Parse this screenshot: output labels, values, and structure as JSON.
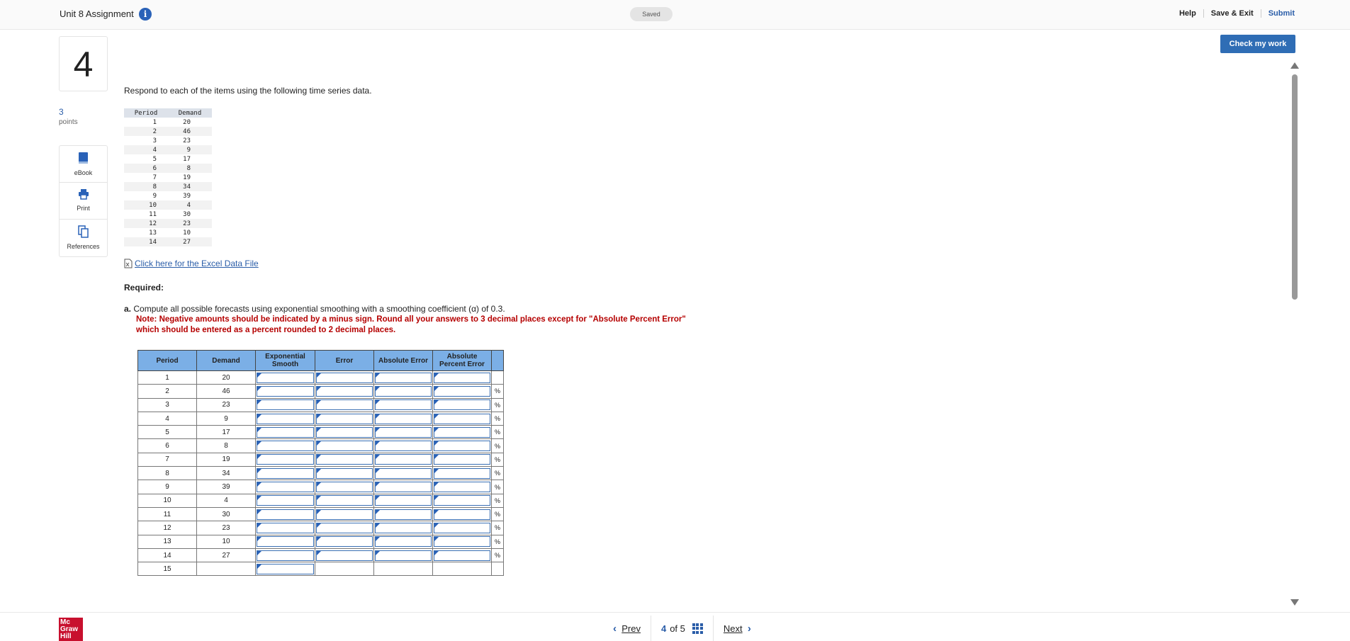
{
  "header": {
    "title": "Unit 8 Assignment",
    "info": "i",
    "saved": "Saved",
    "links": [
      "Help",
      "Save & Exit",
      "Submit"
    ]
  },
  "question": {
    "number": "4",
    "points_value": "3",
    "points_label": "points"
  },
  "tools": [
    {
      "label": "eBook",
      "icon": "book-icon"
    },
    {
      "label": "Print",
      "icon": "printer-icon"
    },
    {
      "label": "References",
      "icon": "references-icon"
    }
  ],
  "check_button": "Check my work",
  "intro": "Respond to each of the items using the following time series data.",
  "data_table": {
    "headers": [
      "Period",
      "Demand"
    ],
    "rows": [
      [
        "1",
        "20"
      ],
      [
        "2",
        "46"
      ],
      [
        "3",
        "23"
      ],
      [
        "4",
        "9"
      ],
      [
        "5",
        "17"
      ],
      [
        "6",
        "8"
      ],
      [
        "7",
        "19"
      ],
      [
        "8",
        "34"
      ],
      [
        "9",
        "39"
      ],
      [
        "10",
        "4"
      ],
      [
        "11",
        "30"
      ],
      [
        "12",
        "23"
      ],
      [
        "13",
        "10"
      ],
      [
        "14",
        "27"
      ]
    ]
  },
  "excel_link": "Click here for the Excel Data File",
  "required_label": "Required:",
  "part_a": {
    "letter": "a.",
    "text": "Compute all possible forecasts using exponential smoothing with a smoothing coefficient (α) of 0.3.",
    "note": "Note: Negative amounts should be indicated by a minus sign. Round all your answers to 3 decimal places except for \"Absolute Percent Error\" which should be entered as a percent rounded to 2 decimal places."
  },
  "answer_table": {
    "headers": [
      "Period",
      "Demand",
      "Exponential Smooth",
      "Error",
      "Absolute Error",
      "Absolute Percent Error"
    ],
    "percent_symbol": "%",
    "rows": [
      [
        "1",
        "20"
      ],
      [
        "2",
        "46"
      ],
      [
        "3",
        "23"
      ],
      [
        "4",
        "9"
      ],
      [
        "5",
        "17"
      ],
      [
        "6",
        "8"
      ],
      [
        "7",
        "19"
      ],
      [
        "8",
        "34"
      ],
      [
        "9",
        "39"
      ],
      [
        "10",
        "4"
      ],
      [
        "11",
        "30"
      ],
      [
        "12",
        "23"
      ],
      [
        "13",
        "10"
      ],
      [
        "14",
        "27"
      ],
      [
        "15",
        ""
      ]
    ]
  },
  "pager": {
    "prev": "Prev",
    "current": "4",
    "of": "of",
    "total": "5",
    "next": "Next"
  },
  "logo": "Mc Graw Hill"
}
